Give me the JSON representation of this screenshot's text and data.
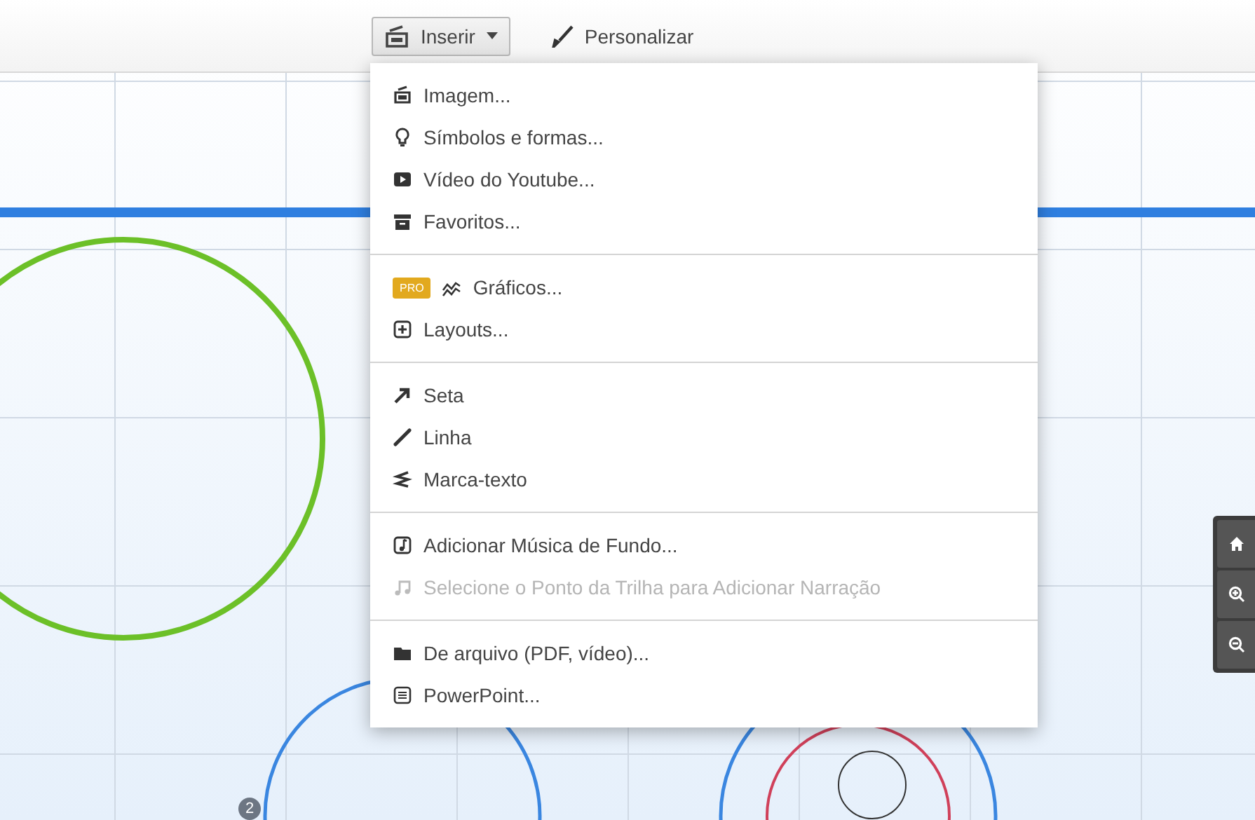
{
  "toolbar": {
    "buttons": [
      {
        "label": "Inserir",
        "expanded": true
      },
      {
        "label": "Personalizar",
        "expanded": false
      }
    ]
  },
  "menu": {
    "groups": [
      [
        {
          "label": "Imagem...",
          "disabled": false
        },
        {
          "label": "Símbolos e formas...",
          "disabled": false
        },
        {
          "label": "Vídeo do Youtube...",
          "disabled": false
        },
        {
          "label": "Favoritos...",
          "disabled": false
        }
      ],
      [
        {
          "label": "Gráficos...",
          "disabled": false,
          "badge": "PRO"
        },
        {
          "label": "Layouts...",
          "disabled": false
        }
      ],
      [
        {
          "label": "Seta",
          "disabled": false
        },
        {
          "label": "Linha",
          "disabled": false
        },
        {
          "label": "Marca-texto",
          "disabled": false
        }
      ],
      [
        {
          "label": "Adicionar Música de Fundo...",
          "disabled": false
        },
        {
          "label": "Selecione o Ponto da Trilha para Adicionar Narração",
          "disabled": true
        }
      ],
      [
        {
          "label": "De arquivo (PDF, vídeo)...",
          "disabled": false
        },
        {
          "label": "PowerPoint...",
          "disabled": false
        }
      ]
    ]
  },
  "canvas": {
    "step_badge": "2"
  }
}
